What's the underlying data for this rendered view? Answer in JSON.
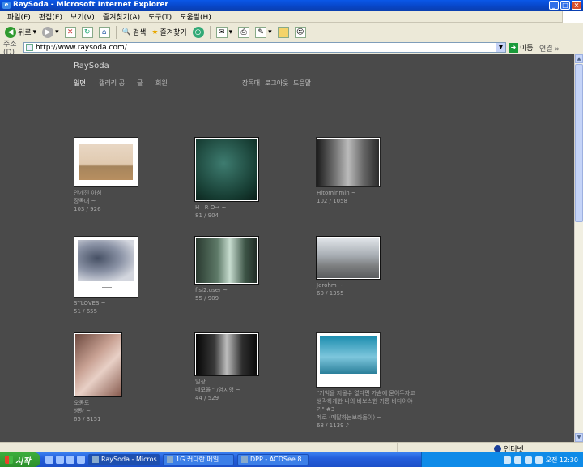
{
  "window": {
    "title": "RaySoda - Microsoft Internet Explorer"
  },
  "menu": [
    "파일(F)",
    "편집(E)",
    "보기(V)",
    "즐겨찾기(A)",
    "도구(T)",
    "도움말(H)"
  ],
  "toolbar": {
    "back": "뒤로",
    "search": "검색",
    "favorites": "즐겨찾기"
  },
  "address": {
    "label": "주소(D)",
    "url": "http://www.raysoda.com/",
    "go": "이동",
    "links": "연결"
  },
  "site": {
    "title": "RaySoda",
    "nav": [
      "일면",
      "갤러리 공",
      "글",
      "회원"
    ],
    "nav_right": [
      "장독대",
      "로그아웃",
      "도움말"
    ]
  },
  "photos": [
    {
      "title": "안개낀 아침",
      "user": "장독대 ~",
      "stats": "103 / 926"
    },
    {
      "title": "H I R O→ ~",
      "user": "",
      "stats": "81 / 904"
    },
    {
      "title": "Hitominmin ~",
      "user": "",
      "stats": "102 / 1058"
    },
    {
      "title": "SYLOVES ~",
      "user": "",
      "stats": "51 / 655"
    },
    {
      "title": "fisi2.user ~",
      "user": "",
      "stats": "55 / 909"
    },
    {
      "title": "Jerohm ~",
      "user": "",
      "stats": "60 / 1355"
    },
    {
      "title": "오동도",
      "user": "생량 ~",
      "stats": "65 / 3151"
    },
    {
      "title": "일상",
      "user": "네모율™/엄지영 ~",
      "stats": "44 / 529"
    },
    {
      "title": "\"기억을 지울수 없다면 가슴에 묻어두자고",
      "user": "생각하게한 나의 비보스한 기롱 바다이야",
      "stats": "기\" #3",
      "extra1": "메로 (메달하는보라돌이) ~",
      "extra2": "68 / 1139 ♪"
    }
  ],
  "status": {
    "zone": "인터넷"
  },
  "taskbar": {
    "start": "시작",
    "tasks": [
      "RaySoda - Micros...",
      "1G 커다란 메일 ...",
      "DPP - ACDSee 8..."
    ],
    "clock": "오전 12:30"
  }
}
